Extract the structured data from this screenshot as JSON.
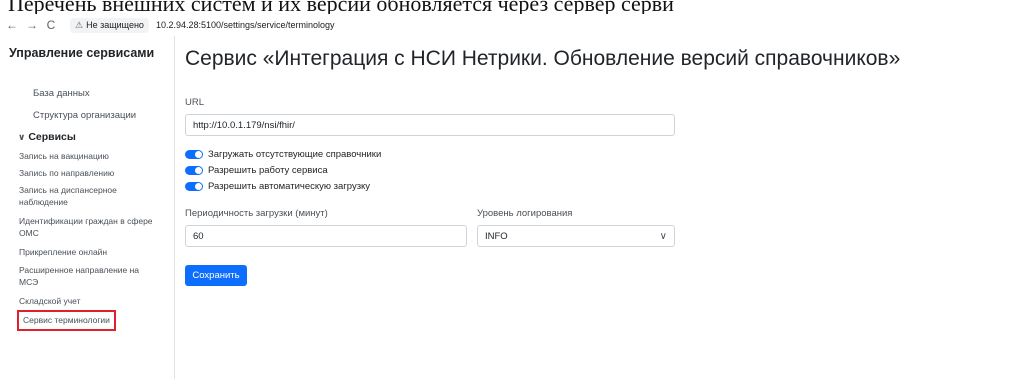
{
  "doc": {
    "text": "Перечень внешних систем и их версии обновляется через сервер серви"
  },
  "browser": {
    "back_icon": "←",
    "forward_icon": "→",
    "reload_icon": "C",
    "warning_icon": "⚠",
    "warning_text": "Не защищено",
    "url": "10.2.94.28:5100/settings/service/terminology"
  },
  "sidebar": {
    "title": "Управление сервисами",
    "items": [
      {
        "label": "База данных"
      },
      {
        "label": "Структура организации"
      }
    ],
    "group": {
      "chevron": "∨",
      "label": "Сервисы"
    },
    "subitems": [
      {
        "label": "Запись на вакцинацию"
      },
      {
        "label": "Запись по направлению"
      },
      {
        "label": "Запись на диспансерное наблюдение"
      },
      {
        "label": "Идентификации граждан в сфере ОМС"
      },
      {
        "label": "Прикрепление онлайн"
      },
      {
        "label": "Расширенное направление на МСЭ"
      },
      {
        "label": "Складской учет"
      },
      {
        "label": "Сервис терминологии",
        "active": true
      }
    ]
  },
  "main": {
    "title": "Сервис «Интеграция с НСИ Нетрики. Обновление версий справочников»",
    "url_label": "URL",
    "url_value": "http://10.0.1.179/nsi/fhir/",
    "switches": [
      {
        "label": "Загружать отсутствующие справочники",
        "on": true
      },
      {
        "label": "Разрешить работу сервиса",
        "on": true
      },
      {
        "label": "Разрешить автоматическую загрузку",
        "on": true
      }
    ],
    "period_label": "Периодичность загрузки (минут)",
    "period_value": "60",
    "log_label": "Уровень логирования",
    "log_value": "INFO",
    "log_chevron": "∨",
    "save_label": "Сохранить"
  },
  "colors": {
    "accent": "#0d6efd",
    "highlight_border": "#e0212b"
  }
}
